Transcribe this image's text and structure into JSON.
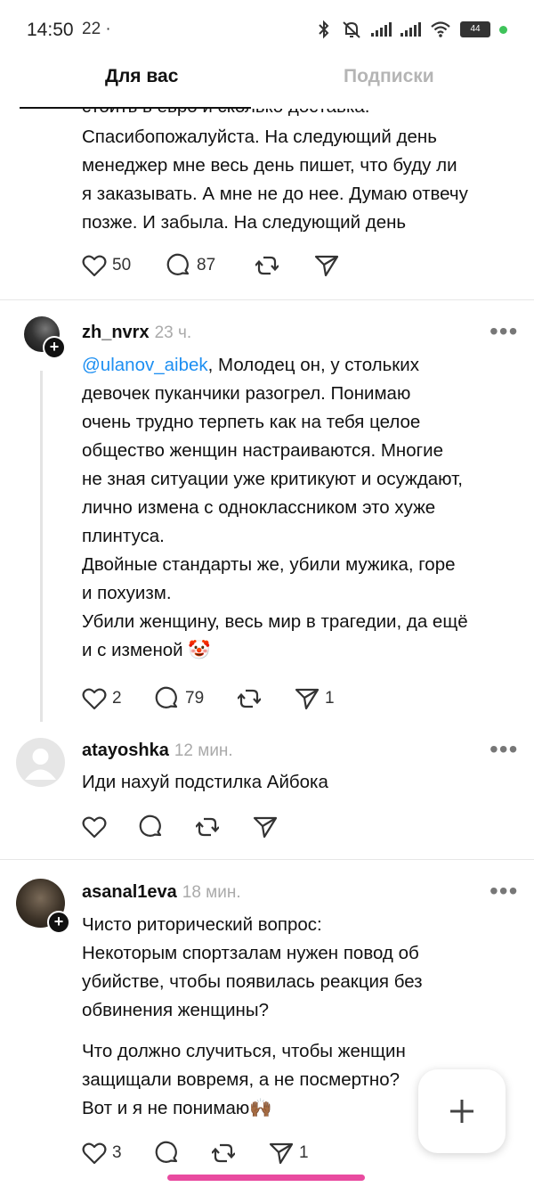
{
  "status_bar": {
    "time": "14:50",
    "notification": "22 ·",
    "battery": "44"
  },
  "tabs": [
    {
      "label": "Для вас",
      "active": true
    },
    {
      "label": "Подписки",
      "active": false
    }
  ],
  "posts": [
    {
      "text_partial_top": "стоить в евро и сколько доставка.",
      "lines": [
        "Спасибопожалуйста. На следующий день",
        "менеджер мне весь день пишет, что буду ли",
        "я заказывать. А мне не до нее. Думаю отвечу",
        "позже. И забыла. На следующий день"
      ],
      "likes": "50",
      "replies": "87"
    },
    {
      "user": "zh_nvrx",
      "time": "23 ч.",
      "mention": "@ulanov_aibek",
      "first_line_rest": ", Молодец он, у стольких",
      "lines": [
        "девочек пуканчики разогрел. Понимаю",
        "очень трудно терпеть как на тебя целое",
        "общество женщин настраиваются. Многие",
        "не зная ситуации уже критикуют и осуждают,",
        "лично измена с одноклассником это хуже",
        "плинтуса.",
        "Двойные стандарты же, убили мужика, горе",
        "и похуизм.",
        "Убили женщину, весь мир в трагедии, да ещё",
        "и с изменой 🤡"
      ],
      "likes": "2",
      "replies": "79",
      "shares": "1"
    },
    {
      "user": "atayoshka",
      "time": "12 мин.",
      "lines": [
        "Иди нахуй подстилка Айбока"
      ]
    },
    {
      "user": "asanal1eva",
      "time": "18 мин.",
      "lines": [
        "Чисто риторический вопрос:",
        "Некоторым спортзалам нужен повод об",
        "убийстве, чтобы появилась реакция без",
        "обвинения женщины?"
      ],
      "lines2": [
        "Что должно случиться, чтобы женщин",
        "защищали вовремя, а не посмертно?",
        "Вот и я не понимаю🙌🏾"
      ],
      "likes": "3",
      "shares": "1"
    }
  ],
  "colors": {
    "mention": "#1d8ff2",
    "home_indicator": "#e94ba0",
    "inactive_tab": "#b5b5b5"
  }
}
